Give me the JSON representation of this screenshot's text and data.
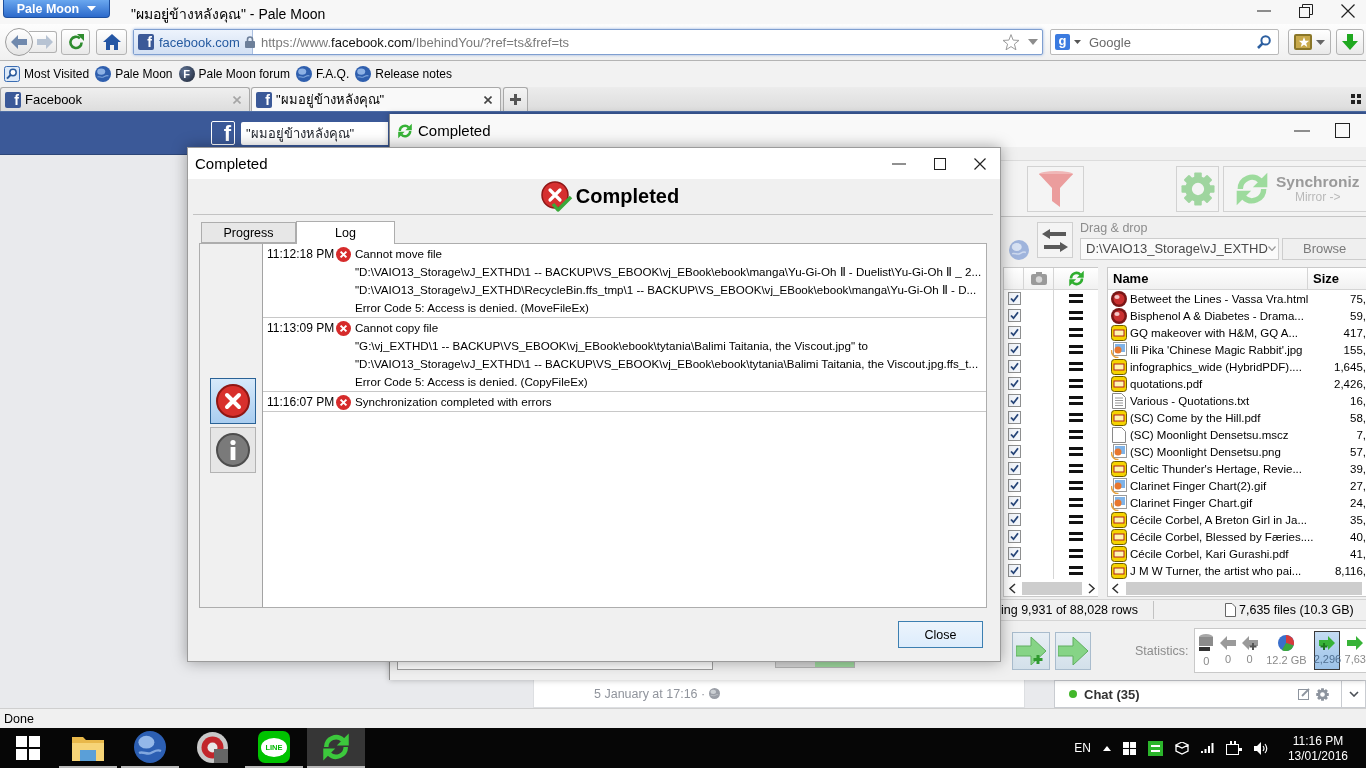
{
  "browser": {
    "menu_button": "Pale Moon",
    "title": "\"ผมอยู่ข้างหลังคุณ\" - Pale Moon",
    "address": {
      "site_logo": "f",
      "site": "facebook.com",
      "url_scheme": "https://www.",
      "url_domain": "facebook.com",
      "url_path": "/IbehindYou/?ref=ts&fref=ts"
    },
    "search": {
      "engine_logo": "g",
      "placeholder": "Google"
    },
    "bookmarks": [
      {
        "kind": "folder",
        "label": "Most Visited"
      },
      {
        "kind": "globe",
        "label": "Pale Moon"
      },
      {
        "kind": "letter",
        "icon_text": "F",
        "label": "Pale Moon forum"
      },
      {
        "kind": "globe",
        "label": "F.A.Q."
      },
      {
        "kind": "globe",
        "label": "Release notes"
      }
    ],
    "tabs": [
      {
        "site_logo": "f",
        "label": "Facebook",
        "selected": false
      },
      {
        "site_logo": "f",
        "label": "\"ผมอยู่ข้างหลังคุณ\"",
        "selected": true
      }
    ],
    "status": "Done"
  },
  "facebook": {
    "logo": "f",
    "search_value": "\"ผมอยู่ข้างหลังคุณ\"",
    "post_time": "5 January at 17:16 ·",
    "chat": "Chat (35)"
  },
  "ffs_window": {
    "title": "Completed",
    "synchronize": "Synchroniz",
    "sync_variant": "Mirror ->",
    "drop_label": "Drag & drop",
    "folder_path": "D:\\VAIO13_Storage\\vJ_EXTHD",
    "browse": "Browse",
    "columns": [
      "Name",
      "Size"
    ],
    "rows": [
      {
        "checked": true,
        "kind": "web",
        "name": "Betweet the Lines - Vassa Vra.html",
        "size": "75,"
      },
      {
        "checked": true,
        "kind": "web",
        "name": "Bisphenol A & Diabetes - Drama...",
        "size": "59,"
      },
      {
        "checked": true,
        "kind": "pdf",
        "name": "GQ makeover with H&M, GQ A...",
        "size": "417,"
      },
      {
        "checked": true,
        "kind": "image",
        "name": "Ili Pika 'Chinese Magic Rabbit'.jpg",
        "size": "155,"
      },
      {
        "checked": true,
        "kind": "pdf",
        "name": "infographics_wide (HybridPDF)....",
        "size": "1,645,"
      },
      {
        "checked": true,
        "kind": "pdf",
        "name": "quotations.pdf",
        "size": "2,426,"
      },
      {
        "checked": true,
        "kind": "text",
        "name": "Various - Quotations.txt",
        "size": "16,"
      },
      {
        "checked": true,
        "kind": "pdf",
        "name": "(SC) Come by the Hill.pdf",
        "size": "58,"
      },
      {
        "checked": true,
        "kind": "blank",
        "name": "(SC) Moonlight Densetsu.mscz",
        "size": "7,"
      },
      {
        "checked": true,
        "kind": "image",
        "name": "(SC) Moonlight Densetsu.png",
        "size": "57,"
      },
      {
        "checked": true,
        "kind": "pdf",
        "name": "Celtic Thunder's Hertage, Revie...",
        "size": "39,"
      },
      {
        "checked": true,
        "kind": "image",
        "name": "Clarinet Finger Chart(2).gif",
        "size": "27,"
      },
      {
        "checked": true,
        "kind": "image",
        "name": "Clarinet Finger Chart.gif",
        "size": "24,"
      },
      {
        "checked": true,
        "kind": "pdf",
        "name": "Cécile Corbel, A Breton Girl in Ja...",
        "size": "35,"
      },
      {
        "checked": true,
        "kind": "pdf",
        "name": "Cécile Corbel, Blessed by Færies....",
        "size": "40,"
      },
      {
        "checked": true,
        "kind": "pdf",
        "name": "Cécile Corbel, Kari Gurashi.pdf",
        "size": "41,"
      },
      {
        "checked": true,
        "kind": "pdf",
        "name": "J M W Turner, the artist who pai...",
        "size": "8,116,"
      }
    ],
    "status_rows": "ing 9,931 of 88,028 rows",
    "status_files": "7,635 files (10.3 GB)",
    "statistics_label": "Statistics:",
    "statistics": [
      {
        "kind": "delete_left",
        "value": "0",
        "highlighted": false
      },
      {
        "kind": "update_left",
        "value": "0",
        "highlighted": false
      },
      {
        "kind": "create_left",
        "value": "0",
        "highlighted": false
      },
      {
        "kind": "data",
        "value": "12.2 GB",
        "highlighted": false
      },
      {
        "kind": "create_right",
        "value": "2,296",
        "highlighted": true
      },
      {
        "kind": "update_right",
        "value": "7,63",
        "highlighted": false
      }
    ]
  },
  "dialog": {
    "title": "Completed",
    "heading": "Completed",
    "tabs": [
      {
        "label": "Progress",
        "selected": false
      },
      {
        "label": "Log",
        "selected": true
      }
    ],
    "filters": [
      {
        "kind": "error",
        "selected": true
      },
      {
        "kind": "info",
        "selected": false
      }
    ],
    "log": [
      {
        "time": "11:12:18 PM",
        "kind": "error",
        "lines": [
          "Cannot move file",
          "\"D:\\VAIO13_Storage\\vJ_EXTHD\\1 -- BACKUP\\VS_EBOOK\\vj_EBook\\ebook\\manga\\Yu-Gi-Oh Ⅱ - Duelist\\Yu-Gi-Oh Ⅱ _ 2...",
          "\"D:\\VAIO13_Storage\\vJ_EXTHD\\RecycleBin.ffs_tmp\\1 -- BACKUP\\VS_EBOOK\\vj_EBook\\ebook\\manga\\Yu-Gi-Oh Ⅱ - D...",
          "Error Code 5: Access is denied. (MoveFileEx)"
        ]
      },
      {
        "time": "11:13:09 PM",
        "kind": "error",
        "lines": [
          "Cannot copy file",
          "\"G:\\vj_EXTHD\\1 -- BACKUP\\VS_EBOOK\\vj_EBook\\ebook\\tytania\\Balimi Taitania, the Viscout.jpg\" to",
          "\"D:\\VAIO13_Storage\\vJ_EXTHD\\1 -- BACKUP\\VS_EBOOK\\vj_EBook\\ebook\\tytania\\Balimi Taitania, the Viscout.jpg.ffs_t...",
          "Error Code 5: Access is denied. (CopyFileEx)"
        ]
      },
      {
        "time": "11:16:07 PM",
        "kind": "error",
        "lines": [
          "Synchronization completed with errors"
        ]
      }
    ],
    "close": "Close"
  },
  "taskbar": {
    "apps": [
      {
        "kind": "explorer",
        "running": true,
        "active": false
      },
      {
        "kind": "browser",
        "running": true,
        "active": false
      },
      {
        "kind": "media",
        "running": false,
        "active": false
      },
      {
        "kind": "chat",
        "label": "LINE",
        "running": true,
        "active": false
      },
      {
        "kind": "sync",
        "running": true,
        "active": true
      }
    ],
    "language": "EN",
    "time": "11:16 PM",
    "date": "13/01/2016"
  }
}
